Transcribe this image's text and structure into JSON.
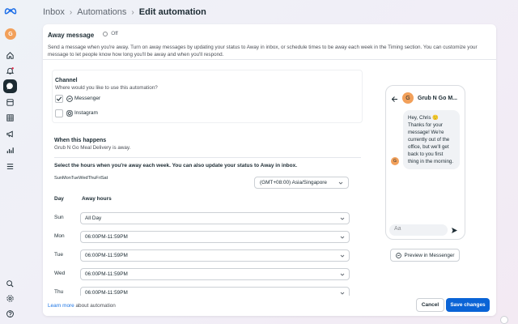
{
  "breadcrumb": {
    "items": [
      "Inbox",
      "Automations"
    ],
    "current": "Edit automation"
  },
  "profile": {
    "initial": "G"
  },
  "away_message": {
    "title": "Away message",
    "toggle_label": "Off",
    "description": "Send a message when you're away. Turn on away messages by updating your status to Away in inbox, or schedule times to be away each week in the Timing section. You can customize your message to let people know how long you'll be away and when you'll respond."
  },
  "channel": {
    "title": "Channel",
    "subtitle": "Where would you like to use this automation?",
    "options": [
      {
        "label": "Messenger",
        "checked": true
      },
      {
        "label": "Instagram",
        "checked": false
      }
    ]
  },
  "when": {
    "title": "When this happens",
    "subtitle": "Grub N Go Meal Delivery is away.",
    "instruction": "Select the hours when you're away each week. You can also update your status to Away in inbox.",
    "days_compact": "SunMonTueWedThuFriSat",
    "timezone": "(GMT+08:00) Asia/Singapore",
    "col_day": "Day",
    "col_hours": "Away hours",
    "rows": [
      {
        "day": "Sun",
        "hours": "All Day"
      },
      {
        "day": "Mon",
        "hours": "06:00PM-11:59PM"
      },
      {
        "day": "Tue",
        "hours": "06:00PM-11:59PM"
      },
      {
        "day": "Wed",
        "hours": "06:00PM-11:59PM"
      },
      {
        "day": "Thu",
        "hours": "06:00PM-11:59PM"
      }
    ]
  },
  "footer": {
    "learn_link": "Learn more",
    "learn_rest": " about automation",
    "cancel": "Cancel",
    "save": "Save changes"
  },
  "preview": {
    "page_name": "Grub N Go M...",
    "avatar": "G",
    "message": "Hey, Chris 🙂 Thanks for your message! We're currently out of the office, but we'll get back to you first thing in the morning.",
    "input_placeholder": "Aa",
    "button": "Preview in Messenger"
  },
  "colors": {
    "primary": "#0a64d6",
    "avatar": "#f2a05a",
    "dark": "#1c2b33"
  }
}
